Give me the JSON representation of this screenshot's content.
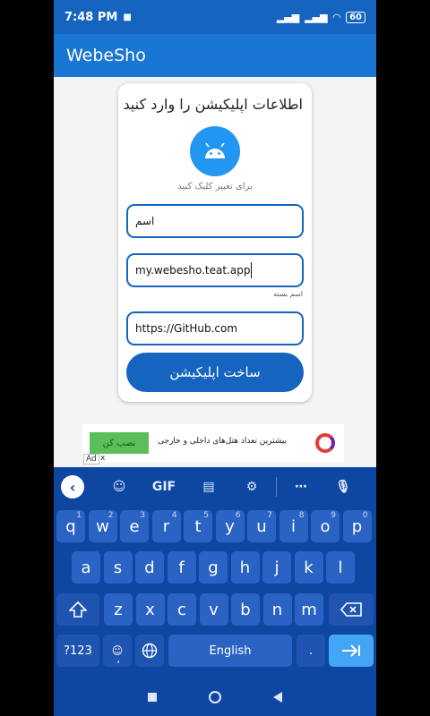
{
  "status_bar": {
    "time": "7:48 PM",
    "battery": "60"
  },
  "app_bar": {
    "title": "WebeSho"
  },
  "card": {
    "title": "اطلاعات اپلیکیشن را وارد کنید",
    "icon_caption": "برای تغییر کلیک کنید",
    "app_name_field": {
      "value": "اسم"
    },
    "package_field": {
      "value": "my.webesho.teat.app",
      "helper": "اسم بسته"
    },
    "url_field": {
      "value": "https://GitHub.com"
    },
    "create_button": "ساخت اپلیکیشن"
  },
  "ad": {
    "button": "نصب کن",
    "text": "بیشترین تعداد هتل‌های داخلی و خارجی",
    "badge": "Ad",
    "close": "x"
  },
  "keyboard": {
    "toolbar": {
      "gif": "GIF"
    },
    "rows": [
      [
        {
          "k": "q",
          "s": "1"
        },
        {
          "k": "w",
          "s": "2"
        },
        {
          "k": "e",
          "s": "3"
        },
        {
          "k": "r",
          "s": "4"
        },
        {
          "k": "t",
          "s": "5"
        },
        {
          "k": "y",
          "s": "6"
        },
        {
          "k": "u",
          "s": "7"
        },
        {
          "k": "i",
          "s": "8"
        },
        {
          "k": "o",
          "s": "9"
        },
        {
          "k": "p",
          "s": "0"
        }
      ],
      [
        {
          "k": "a"
        },
        {
          "k": "s"
        },
        {
          "k": "d"
        },
        {
          "k": "f"
        },
        {
          "k": "g"
        },
        {
          "k": "h"
        },
        {
          "k": "j"
        },
        {
          "k": "k"
        },
        {
          "k": "l"
        }
      ],
      [
        {
          "k": "z"
        },
        {
          "k": "x"
        },
        {
          "k": "c"
        },
        {
          "k": "v"
        },
        {
          "k": "b"
        },
        {
          "k": "n"
        },
        {
          "k": "m"
        }
      ]
    ],
    "symbols_key": "?123",
    "comma_key": ",",
    "space_label": "English",
    "period_key": "."
  }
}
